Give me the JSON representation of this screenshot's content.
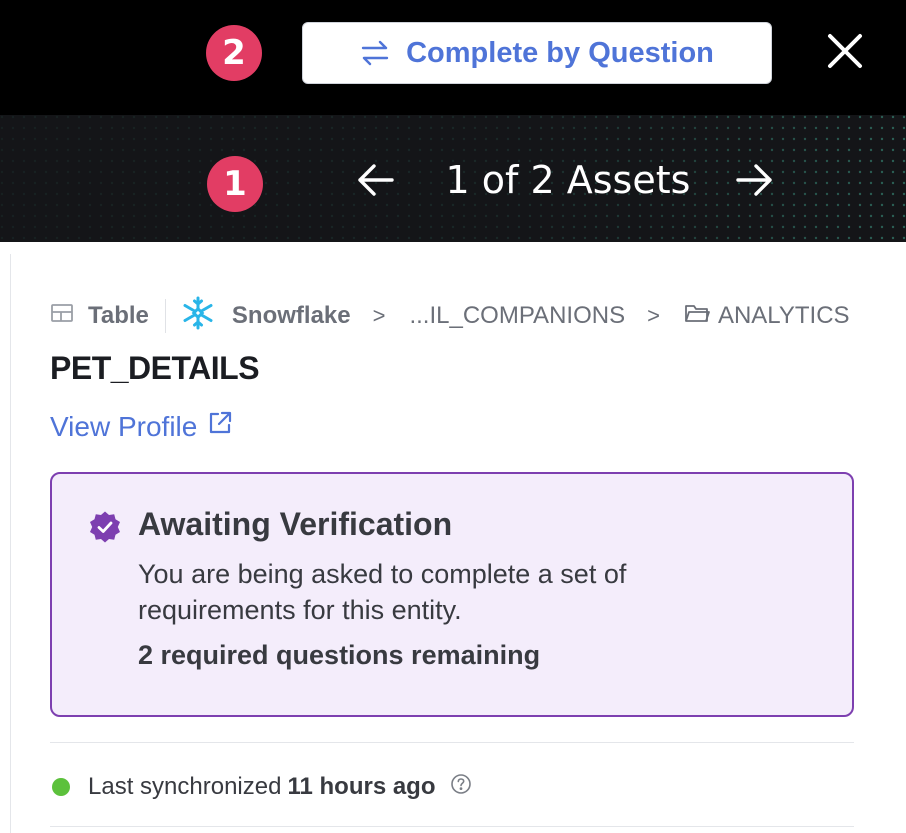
{
  "header": {
    "badge_2": "2",
    "complete_button_label": "Complete by Question"
  },
  "navigation": {
    "badge_1": "1",
    "position_label": "1 of 2 Assets"
  },
  "breadcrumb": {
    "type_label": "Table",
    "source_label": "Snowflake",
    "database_label": "...IL_COMPANIONS",
    "schema_label": "ANALYTICS"
  },
  "asset": {
    "name": "PET_DETAILS",
    "view_profile_label": "View Profile"
  },
  "verification": {
    "title": "Awaiting Verification",
    "description": "You are being asked to complete a set of requirements for this entity.",
    "remaining": "2 required questions remaining"
  },
  "sync": {
    "prefix": "Last synchronized",
    "time": "11 hours ago"
  },
  "colors": {
    "accent_blue": "#4f74d8",
    "badge_pink": "#e23d64",
    "verify_purple": "#7d3fb0",
    "status_green": "#5cc13c"
  },
  "icons": [
    "swap-icon",
    "close-icon",
    "arrow-left-icon",
    "arrow-right-icon",
    "table-icon",
    "snowflake-icon",
    "folder-icon",
    "external-link-icon",
    "verified-badge-icon",
    "help-icon"
  ]
}
